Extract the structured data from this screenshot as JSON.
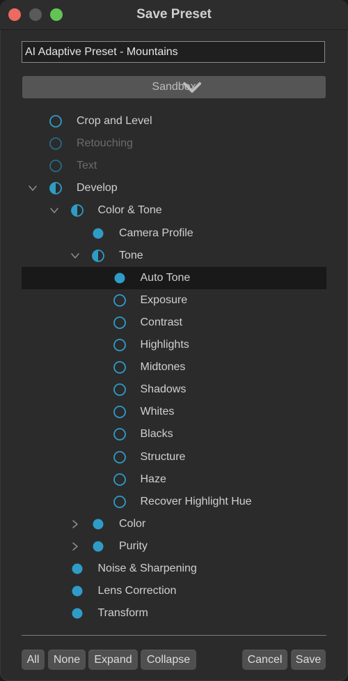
{
  "window": {
    "title": "Save Preset"
  },
  "preset_name": {
    "value": "AI Adaptive Preset - Mountains"
  },
  "category": {
    "selected": "Sandbox"
  },
  "colors": {
    "accent": "#2f9cc8",
    "selection": "#191919"
  },
  "tree": [
    {
      "label": "Crop and Level",
      "state": "unchecked",
      "enabled": true
    },
    {
      "label": "Retouching",
      "state": "unchecked",
      "enabled": false
    },
    {
      "label": "Text",
      "state": "unchecked",
      "enabled": false
    },
    {
      "label": "Develop",
      "state": "mixed",
      "enabled": true,
      "disclosure": "expanded"
    },
    {
      "label": "Color & Tone",
      "state": "mixed",
      "enabled": true,
      "disclosure": "expanded"
    },
    {
      "label": "Camera Profile",
      "state": "checked",
      "enabled": true
    },
    {
      "label": "Tone",
      "state": "mixed",
      "enabled": true,
      "disclosure": "expanded"
    },
    {
      "label": "Auto Tone",
      "state": "checked",
      "enabled": true,
      "selected": true
    },
    {
      "label": "Exposure",
      "state": "unchecked",
      "enabled": true
    },
    {
      "label": "Contrast",
      "state": "unchecked",
      "enabled": true
    },
    {
      "label": "Highlights",
      "state": "unchecked",
      "enabled": true
    },
    {
      "label": "Midtones",
      "state": "unchecked",
      "enabled": true
    },
    {
      "label": "Shadows",
      "state": "unchecked",
      "enabled": true
    },
    {
      "label": "Whites",
      "state": "unchecked",
      "enabled": true
    },
    {
      "label": "Blacks",
      "state": "unchecked",
      "enabled": true
    },
    {
      "label": "Structure",
      "state": "unchecked",
      "enabled": true
    },
    {
      "label": "Haze",
      "state": "unchecked",
      "enabled": true
    },
    {
      "label": "Recover Highlight Hue",
      "state": "unchecked",
      "enabled": true
    },
    {
      "label": "Color",
      "state": "checked",
      "enabled": true,
      "disclosure": "collapsed"
    },
    {
      "label": "Purity",
      "state": "checked",
      "enabled": true,
      "disclosure": "collapsed"
    },
    {
      "label": "Noise & Sharpening",
      "state": "checked",
      "enabled": true
    },
    {
      "label": "Lens Correction",
      "state": "checked",
      "enabled": true
    },
    {
      "label": "Transform",
      "state": "checked",
      "enabled": true
    }
  ],
  "buttons": {
    "all": "All",
    "none": "None",
    "expand": "Expand",
    "collapse": "Collapse",
    "cancel": "Cancel",
    "save": "Save"
  }
}
